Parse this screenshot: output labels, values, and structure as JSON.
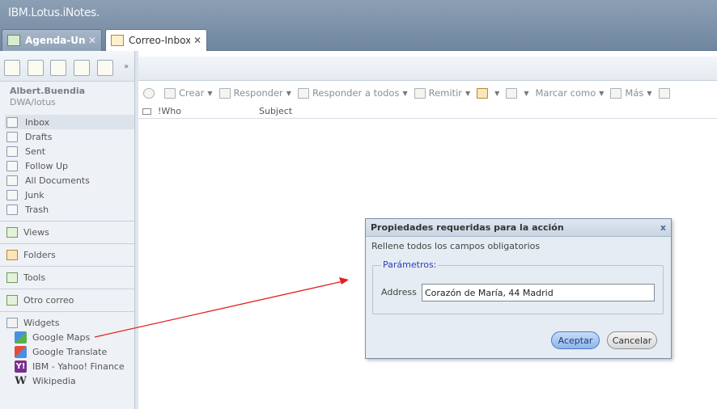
{
  "app": {
    "title": "IBM.Lotus.iNotes."
  },
  "tabs": [
    {
      "label": "Agenda-Un ...",
      "close": "✕"
    },
    {
      "label": "Correo-Inbox",
      "close": "✕"
    }
  ],
  "sidebar": {
    "user_name": "Albert.Buendia",
    "user_server": "DWA/lotus",
    "chevron": "»",
    "mail_items": [
      {
        "label": "Inbox",
        "icon": "inbox-icon"
      },
      {
        "label": "Drafts",
        "icon": "drafts-icon"
      },
      {
        "label": "Sent",
        "icon": "sent-icon"
      },
      {
        "label": "Follow Up",
        "icon": "flag-icon"
      },
      {
        "label": "All Documents",
        "icon": "all-documents-icon"
      },
      {
        "label": "Junk",
        "icon": "junk-icon"
      },
      {
        "label": "Trash",
        "icon": "trash-icon"
      }
    ],
    "sections": [
      {
        "label": "Views"
      },
      {
        "label": "Folders"
      },
      {
        "label": "Tools"
      },
      {
        "label": "Otro correo"
      },
      {
        "label": "Widgets"
      }
    ],
    "widgets": [
      {
        "label": "Google Maps",
        "glyph": ""
      },
      {
        "label": "Google Translate",
        "glyph": ""
      },
      {
        "label": "IBM - Yahoo! Finance",
        "glyph": "Y!"
      },
      {
        "label": "Wikipedia",
        "glyph": "W"
      }
    ]
  },
  "toolbar": {
    "crear": "Crear",
    "responder": "Responder",
    "responder_todos": "Responder a todos",
    "remitir": "Remitir",
    "marcar": "Marcar como",
    "mas": "Más",
    "dropdown_arrow": "▼"
  },
  "columns": {
    "who": "!Who",
    "subject": "Subject"
  },
  "dialog": {
    "title": "Propiedades requeridas para la acción",
    "close": "x",
    "instruction": "Rellene todos los campos obligatorios",
    "legend": "Parámetros:",
    "address_label": "Address",
    "address_value": "Corazón de María, 44 Madrid",
    "ok": "Aceptar",
    "cancel": "Cancelar"
  },
  "colors": {
    "accent": "#7d92a9",
    "annotation_arrow": "#e02020"
  }
}
